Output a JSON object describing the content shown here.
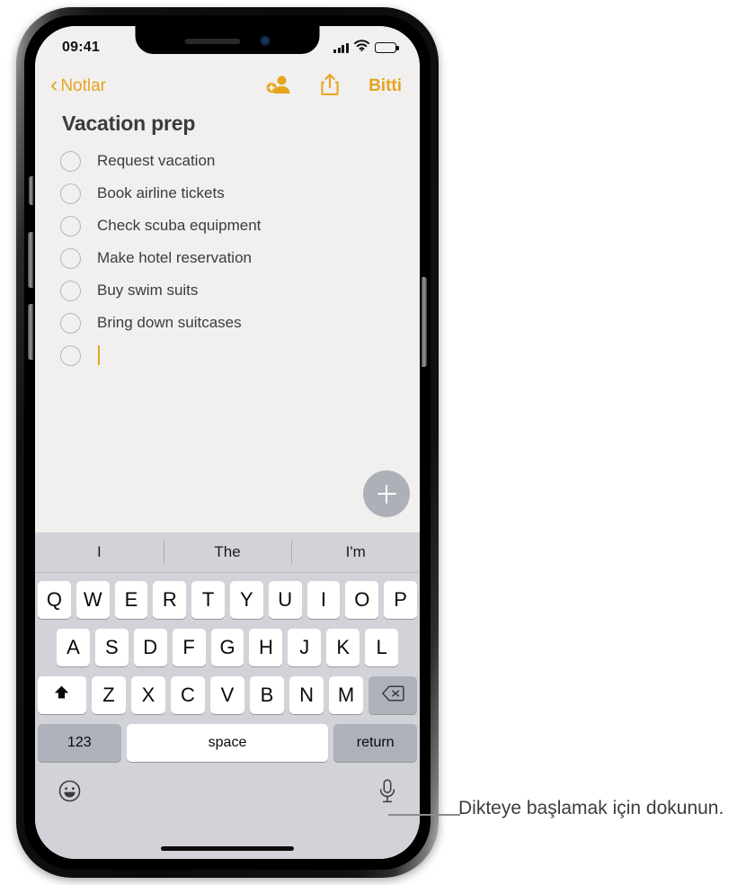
{
  "status_bar": {
    "time": "09:41",
    "signal_icon": "cellular-signal-icon",
    "wifi_icon": "wifi-icon",
    "battery_icon": "battery-icon"
  },
  "note_toolbar": {
    "back_chevron": "‹",
    "back_label": "Notlar",
    "add_person_icon": "add-person-icon",
    "share_icon": "share-icon",
    "done_label": "Bitti"
  },
  "note": {
    "title": "Vacation prep",
    "items": [
      {
        "text": "Request vacation",
        "checked": false
      },
      {
        "text": "Book airline tickets",
        "checked": false
      },
      {
        "text": "Check scuba equipment",
        "checked": false
      },
      {
        "text": "Make hotel reservation",
        "checked": false
      },
      {
        "text": "Buy swim suits",
        "checked": false
      },
      {
        "text": "Bring down suitcases",
        "checked": false
      }
    ],
    "empty_item_caret": true,
    "add_button_icon": "plus-icon"
  },
  "keyboard": {
    "suggestions": [
      "I",
      "The",
      "I'm"
    ],
    "row_top": [
      "Q",
      "W",
      "E",
      "R",
      "T",
      "Y",
      "U",
      "I",
      "O",
      "P"
    ],
    "row_middle": [
      "A",
      "S",
      "D",
      "F",
      "G",
      "H",
      "J",
      "K",
      "L"
    ],
    "row_bottom_letters": [
      "Z",
      "X",
      "C",
      "V",
      "B",
      "N",
      "M"
    ],
    "shift_icon": "shift-arrow-icon",
    "backspace_icon": "backspace-icon",
    "numeric_label": "123",
    "space_label": "space",
    "return_label": "return",
    "emoji_icon": "emoji-smiley-icon",
    "dictation_icon": "microphone-icon"
  },
  "callout": {
    "text": "Dikteye başlamak için dokunun."
  },
  "colors": {
    "accent": "#e6a520",
    "note_background": "#f3f2f0",
    "keyboard_background": "#d1d3d9",
    "key_white": "#ffffff",
    "key_dark": "#aeb1ba",
    "callout_text": "#3d3d3d"
  }
}
